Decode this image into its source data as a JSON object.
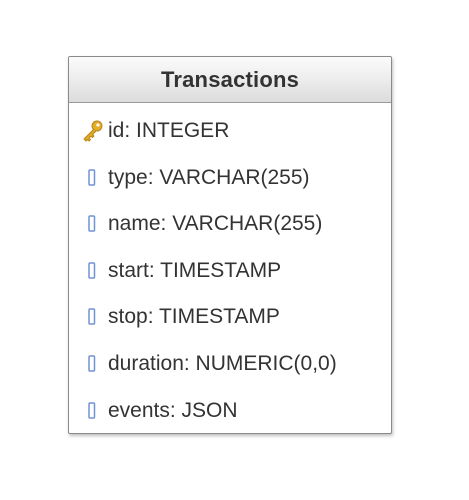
{
  "entity": {
    "title": "Transactions",
    "attributes": [
      {
        "text": "id: INTEGER",
        "icon": "key-icon",
        "is_key": true
      },
      {
        "text": "type: VARCHAR(255)",
        "icon": "column-icon",
        "is_key": false
      },
      {
        "text": "name: VARCHAR(255)",
        "icon": "column-icon",
        "is_key": false
      },
      {
        "text": "start: TIMESTAMP",
        "icon": "column-icon",
        "is_key": false
      },
      {
        "text": "stop: TIMESTAMP",
        "icon": "column-icon",
        "is_key": false
      },
      {
        "text": "duration: NUMERIC(0,0)",
        "icon": "column-icon",
        "is_key": false
      },
      {
        "text": "events: JSON",
        "icon": "column-icon",
        "is_key": false
      }
    ]
  },
  "colors": {
    "key": "#d9a21b",
    "column": "#6f93d6",
    "text": "#333333",
    "border": "#8a8a8a"
  }
}
